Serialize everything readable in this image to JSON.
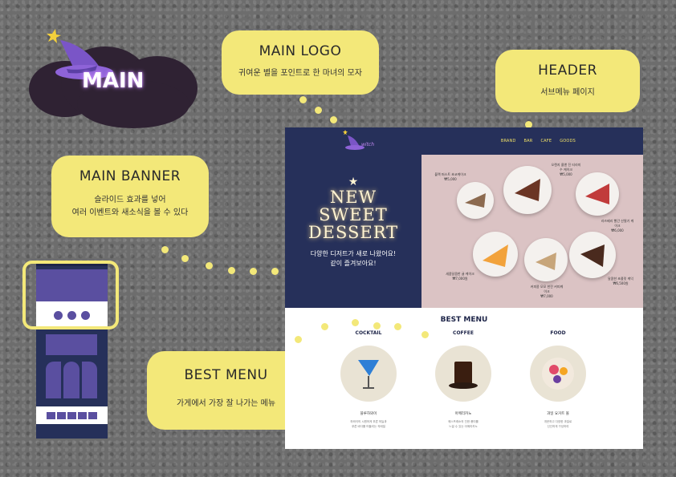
{
  "logo_badge": {
    "text": "MAIN"
  },
  "bubbles": {
    "main_logo": {
      "title": "MAIN LOGO",
      "desc": "귀여운 별을 포인트로 한 마녀의 모자"
    },
    "header": {
      "title": "HEADER",
      "desc": "서브메뉴 페이지"
    },
    "main_banner": {
      "title": "MAIN BANNER",
      "desc_line1": "슬라이드 효과를 넣어",
      "desc_line2": "여러 이벤트와 새소식을 볼 수 있다"
    },
    "best_menu": {
      "title": "BEST MENU",
      "desc": "가게에서 가장 잘 나가는 메뉴"
    }
  },
  "site": {
    "logo_text": "witch",
    "nav": [
      "BRAND",
      "BAR",
      "CAFE",
      "GOODS"
    ],
    "banner": {
      "title_lines": [
        "NEW",
        "SWEET",
        "DESSERT"
      ],
      "sub_line1": "다양한 디저트가 새로 나왔어요!",
      "sub_line2": "같이 즐겨보아요!",
      "items": [
        {
          "name": "블랙 퍼스트 초코케이크",
          "price": "₩5,000"
        },
        {
          "name": "오렌지 올앤 진 티라미수 케이크",
          "price": "₩5,000"
        },
        {
          "name": "라즈베리 빨간 산딸기 케이크",
          "price": "₩6,000"
        },
        {
          "name": "새콤달콤한 귤 케이크",
          "price": "₩7,000원"
        },
        {
          "name": "커피콩 모모 한잔 커피케이크",
          "price": "₩7,000"
        },
        {
          "name": "달콤한 초콜릿 케익",
          "price": "₩6,500원"
        }
      ]
    },
    "best_menu": {
      "title": "BEST MENU",
      "columns": [
        {
          "category": "COCKTAIL",
          "name": "블루하와이",
          "desc_line1": "하와이의 시원하게 푸른 하늘과",
          "desc_line2": "푸른 바다를 떠올리는 칵테일"
        },
        {
          "category": "COFFEE",
          "name": "아메리카노",
          "desc_line1": "에스프레소의 진한 풍미를",
          "desc_line2": "느낄 수 있는 아메리카노"
        },
        {
          "category": "FOOD",
          "name": "과일 요거트 볼",
          "desc_line1": "개운하고 다양한 과일로",
          "desc_line2": "신선하게 구성하여"
        }
      ]
    }
  },
  "colors": {
    "navy": "#26305a",
    "yellow": "#f3e879",
    "pink": "#dbc3c4",
    "purple": "#5a4fa0"
  }
}
